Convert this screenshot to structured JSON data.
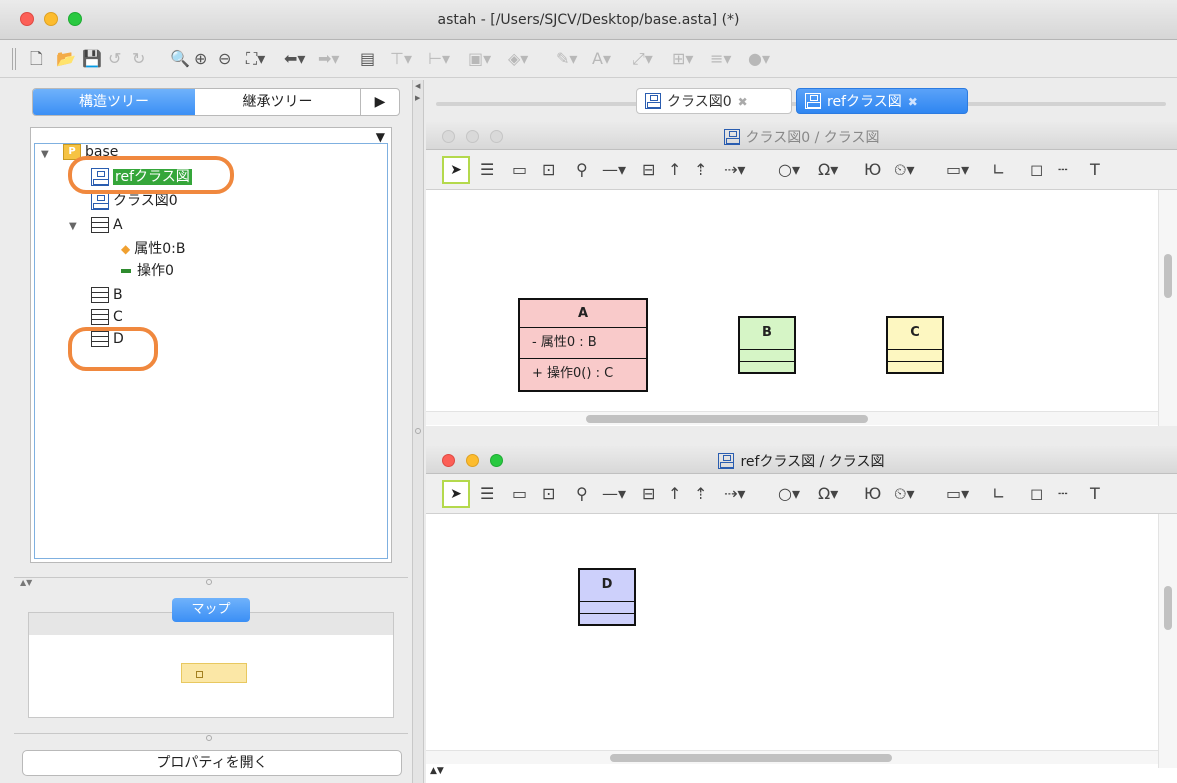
{
  "window": {
    "title": "astah - [/Users/SJCV/Desktop/base.asta] (*)"
  },
  "left_panel": {
    "tabs": {
      "active": "構造ツリー",
      "other": "継承ツリー",
      "arrow": "▶"
    },
    "tree": {
      "root": "base",
      "nodes": [
        {
          "label": "refクラス図",
          "kind": "diagram",
          "selected": true
        },
        {
          "label": "クラス図0",
          "kind": "diagram"
        },
        {
          "label": "A",
          "kind": "class",
          "expanded": true
        },
        {
          "label": "属性0:B",
          "kind": "attribute"
        },
        {
          "label": "操作0",
          "kind": "operation"
        },
        {
          "label": "B",
          "kind": "class"
        },
        {
          "label": "C",
          "kind": "class"
        },
        {
          "label": "D",
          "kind": "class"
        }
      ]
    },
    "map_label": "マップ",
    "properties_button": "プロパティを開く"
  },
  "doc_tabs": [
    {
      "label": "クラス図0",
      "active": false
    },
    {
      "label": "refクラス図",
      "active": true
    }
  ],
  "pane1": {
    "title": "クラス図0 / クラス図",
    "classes": {
      "A": {
        "name": "A",
        "attribute": "- 属性0 : B",
        "operation": "+ 操作0() : C",
        "color": "#f9caca"
      },
      "B": {
        "name": "B",
        "color": "#d6f5c6"
      },
      "C": {
        "name": "C",
        "color": "#fdf7c1"
      }
    }
  },
  "pane2": {
    "title": "refクラス図 / クラス図",
    "classes": {
      "D": {
        "name": "D",
        "color": "#cdd0fb"
      }
    }
  },
  "icons": {
    "toolbar": [
      "new-file-icon",
      "open-folder-icon",
      "save-icon",
      "undo-icon",
      "redo-icon",
      "zoom-fit-icon",
      "zoom-in-icon",
      "zoom-out-icon",
      "fit-window-icon",
      "back-icon",
      "forward-icon"
    ],
    "diagram_toolbar": [
      "select-icon",
      "class-icon",
      "package-icon",
      "subsystem-icon",
      "note-pin-icon",
      "association-icon",
      "generalization-icon",
      "text-icon"
    ]
  },
  "colors": {
    "accent": "#3b8ff5",
    "selection": "#35a63a",
    "highlight_ring": "#f0883e"
  }
}
